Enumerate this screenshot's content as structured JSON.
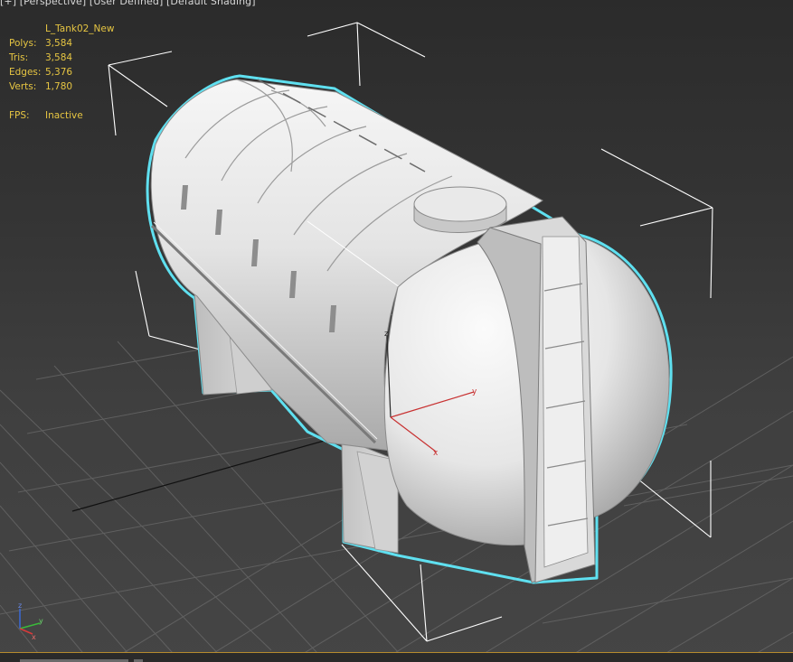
{
  "viewport": {
    "labels": [
      "[+]",
      "[Perspective]",
      "[User Defined]",
      "[Default Shading]"
    ]
  },
  "stats": {
    "object_name": "L_Tank02_New",
    "polys_label": "Polys:",
    "polys_value": "3,584",
    "tris_label": "Tris:",
    "tris_value": "3,584",
    "edges_label": "Edges:",
    "edges_value": "5,376",
    "verts_label": "Verts:",
    "verts_value": "1,780",
    "fps_label": "FPS:",
    "fps_value": "Inactive"
  },
  "gizmo": {
    "x_label": "x",
    "y_label": "y",
    "z_label": "z"
  },
  "view_axis": {
    "x_label": "x",
    "y_label": "y",
    "z_label": "z"
  },
  "colors": {
    "selection_outline": "#5fe0f0",
    "stats_text": "#e6c542",
    "gizmo_x": "#c83232",
    "gizmo_y": "#c83232",
    "gizmo_z": "#2a2a2a",
    "bounding_box": "#ffffff",
    "grid": "#6a6a6a"
  }
}
